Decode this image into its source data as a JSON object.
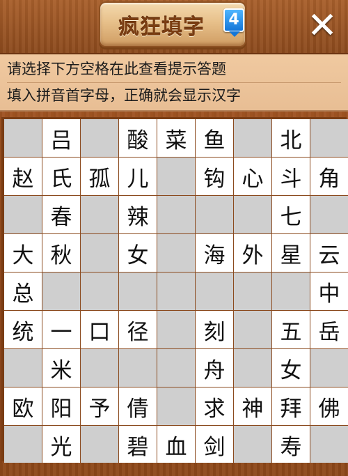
{
  "header": {
    "title": "疯狂填字",
    "level": "4",
    "close_label": "✕"
  },
  "hints": {
    "line1": "请选择下方空格在此查看提示答题",
    "line2": "填入拼音首字母，正确就会显示汉字"
  },
  "grid": {
    "rows": [
      [
        "",
        "吕",
        "",
        "酸",
        "菜",
        "鱼",
        "",
        "北",
        ""
      ],
      [
        "赵",
        "氏",
        "孤",
        "儿",
        "",
        "钩",
        "心",
        "斗",
        "角"
      ],
      [
        "",
        "春",
        "",
        "辣",
        "",
        "",
        "",
        "七",
        ""
      ],
      [
        "大",
        "秋",
        "",
        "女",
        "",
        "海",
        "外",
        "星",
        "云"
      ],
      [
        "总",
        "",
        "",
        "",
        "",
        "",
        "",
        "",
        "中"
      ],
      [
        "统",
        "一",
        "口",
        "径",
        "",
        "刻",
        "",
        "五",
        "岳"
      ],
      [
        "",
        "米",
        "",
        "",
        "",
        "舟",
        "",
        "女",
        ""
      ],
      [
        "欧",
        "阳",
        "予",
        "倩",
        "",
        "求",
        "神",
        "拜",
        "佛"
      ],
      [
        "",
        "光",
        "",
        "碧",
        "血",
        "剑",
        "",
        "寿",
        ""
      ]
    ]
  },
  "colors": {
    "cell_filled": "#ffffff",
    "cell_empty": "#cfcfcf",
    "grid_line": "#8b4a1e",
    "hint_bg": "#f0c9a0",
    "badge": "#1476d8"
  }
}
